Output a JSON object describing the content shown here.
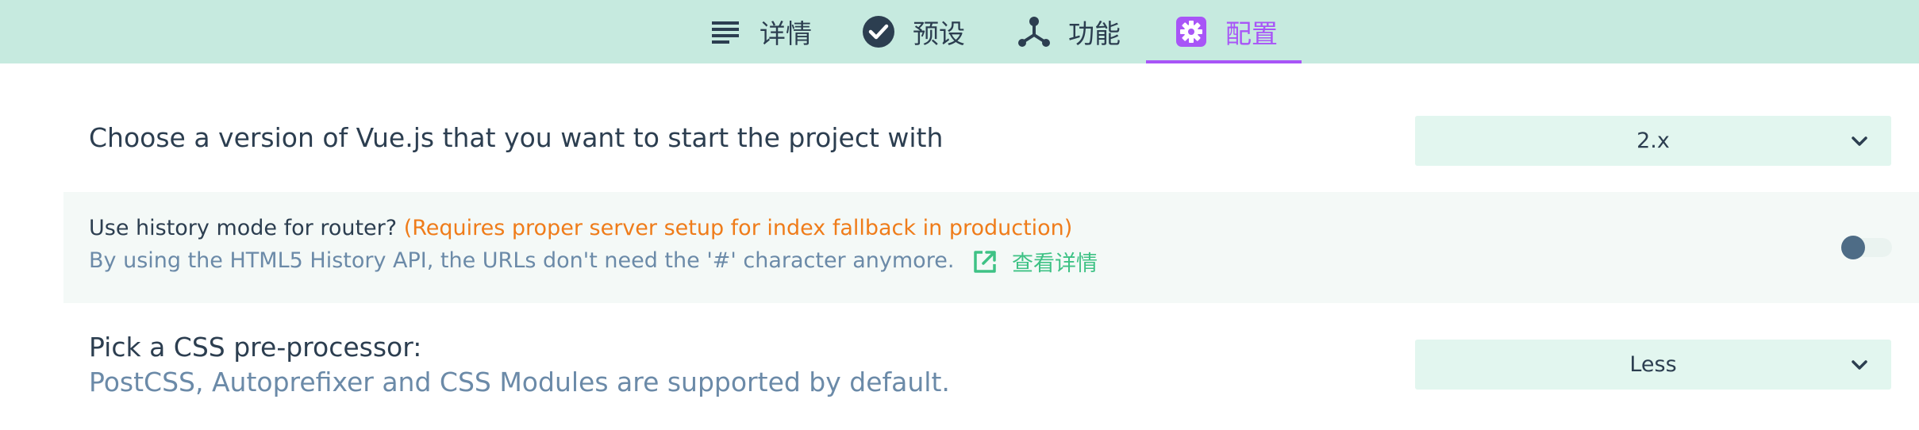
{
  "tabs": [
    {
      "label": "详情",
      "icon": "list-icon",
      "active": false
    },
    {
      "label": "预设",
      "icon": "check-circle-icon",
      "active": false
    },
    {
      "label": "功能",
      "icon": "fork-icon",
      "active": false
    },
    {
      "label": "配置",
      "icon": "gear-icon",
      "active": true
    }
  ],
  "prompts": {
    "vue_version": {
      "question": "Choose a version of Vue.js that you want to start the project with",
      "selected": "2.x"
    },
    "history_mode": {
      "question": "Use history mode for router?",
      "warning": "(Requires proper server setup for index fallback in production)",
      "description": "By using the HTML5 History API, the URLs don't need the '#' character anymore.",
      "link_label": "查看详情",
      "enabled": false
    },
    "css_preprocessor": {
      "question": "Pick a CSS pre-processor:",
      "description": "PostCSS, Autoprefixer and CSS Modules are supported by default.",
      "selected": "Less"
    }
  },
  "colors": {
    "tabbar_bg": "#c6eadf",
    "accent": "#a855f7",
    "warning": "#ef7c1a",
    "link": "#3ec285",
    "select_bg": "#e2f6ef"
  }
}
